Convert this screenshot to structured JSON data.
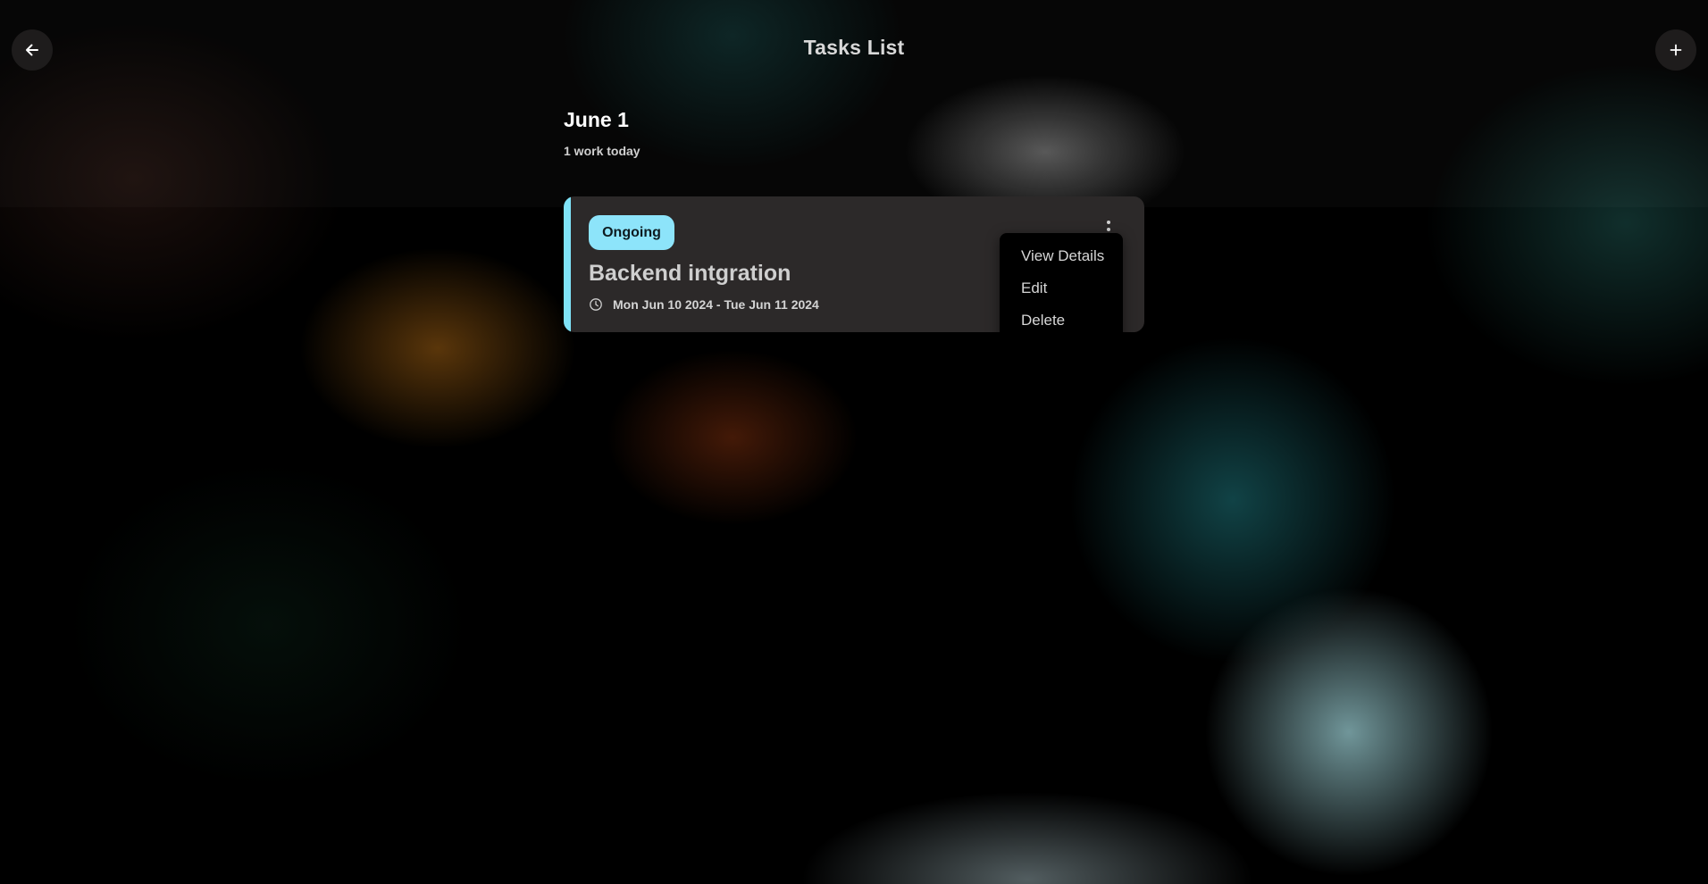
{
  "header": {
    "title": "Tasks List",
    "back_icon": "arrow-left-icon",
    "add_icon": "plus-icon"
  },
  "day": {
    "heading": "June 1",
    "summary": "1 work today"
  },
  "task": {
    "status": "Ongoing",
    "title": "Backend intgration",
    "date_range": "Mon Jun 10 2024 - Tue Jun 11 2024",
    "accent_color": "#7fe3f8",
    "more_icon": "more-vertical-icon",
    "clock_icon": "clock-icon"
  },
  "menu": {
    "items": [
      {
        "label": "View Details"
      },
      {
        "label": "Edit"
      },
      {
        "label": "Delete"
      }
    ]
  },
  "colors": {
    "card_bg": "#2c2929",
    "badge_bg": "#8de4fa",
    "menu_bg": "#000000"
  }
}
